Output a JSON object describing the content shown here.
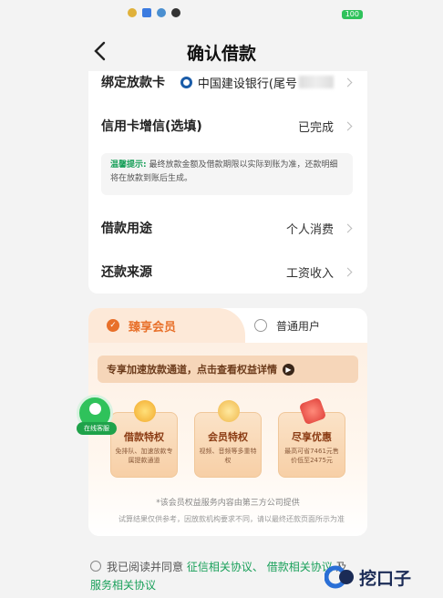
{
  "status_bar": {
    "battery": "100"
  },
  "header": {
    "title": "确认借款"
  },
  "form": {
    "rows": [
      {
        "label": "绑定放款卡",
        "value": "中国建设银行(尾号"
      },
      {
        "label": "信用卡增信(选填)",
        "value": "已完成"
      },
      {
        "label": "借款用途",
        "value": "个人消费"
      },
      {
        "label": "还款来源",
        "value": "工资收入"
      }
    ],
    "tip": {
      "label": "温馨提示:",
      "text": "最终放款金额及借款期限以实际到账为准，还款明细将在放款到账后生成。"
    }
  },
  "membership": {
    "tabs": [
      {
        "label": "臻享会员",
        "selected": true
      },
      {
        "label": "普通用户",
        "selected": false
      }
    ],
    "banner": "专享加速放款通道，点击查看权益详情",
    "benefits": [
      {
        "title": "借款特权",
        "desc": "免排队、加速放款专属提款通道"
      },
      {
        "title": "会员特权",
        "desc": "视频、音频等多重特权"
      },
      {
        "title": "尽享优惠",
        "desc": "最高可省7461元售价低至2475元"
      }
    ],
    "footnote": "*该会员权益服务内容由第三方公司提供",
    "disclaimer": "试算结果仅供参考，因放款机构要求不同，请以最终还款页面所示为准"
  },
  "online_service": {
    "label": "在线客服"
  },
  "agreement": {
    "prefix": "我已阅读并同意",
    "links": [
      "征信相关协议、",
      "借款相关协议",
      "服务相关协议"
    ],
    "joiner": "及"
  },
  "watermark": {
    "text": "挖口子"
  },
  "colors": {
    "accent_green": "#19a05a",
    "member_orange": "#e8702a",
    "bank_blue": "#1a5ca8"
  }
}
